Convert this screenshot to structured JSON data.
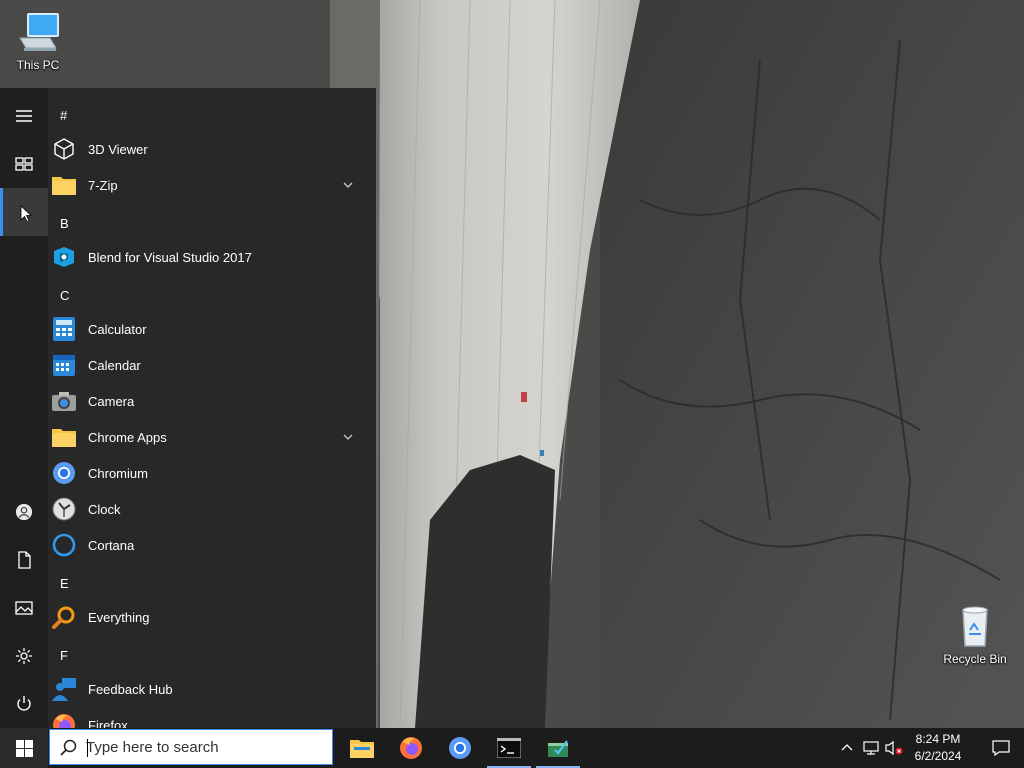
{
  "desktop": {
    "icons": [
      {
        "label": "This PC",
        "icon": "computer-icon"
      },
      {
        "label": "Recycle Bin",
        "icon": "recycle-bin-icon"
      }
    ]
  },
  "start_menu": {
    "rail": [
      {
        "name": "expand",
        "icon": "hamburger-icon"
      },
      {
        "name": "tiles",
        "icon": "tiles-icon"
      },
      {
        "name": "all-apps",
        "icon": "all-apps-icon",
        "active": true
      },
      {
        "name": "account",
        "icon": "user-icon"
      },
      {
        "name": "documents",
        "icon": "document-icon"
      },
      {
        "name": "pictures",
        "icon": "pictures-icon"
      },
      {
        "name": "settings",
        "icon": "gear-icon"
      },
      {
        "name": "power",
        "icon": "power-icon"
      }
    ],
    "headers": {
      "hash": "#",
      "b": "B",
      "c": "C",
      "e": "E",
      "f": "F"
    },
    "apps": {
      "viewer3d": {
        "label": "3D Viewer",
        "icon": "cube-icon"
      },
      "sevenzip": {
        "label": "7-Zip",
        "icon": "folder-icon",
        "expandable": true
      },
      "blend": {
        "label": "Blend for Visual Studio 2017",
        "icon": "blend-icon"
      },
      "calculator": {
        "label": "Calculator",
        "icon": "calculator-icon"
      },
      "calendar": {
        "label": "Calendar",
        "icon": "calendar-icon"
      },
      "camera": {
        "label": "Camera",
        "icon": "camera-icon"
      },
      "chromeapps": {
        "label": "Chrome Apps",
        "icon": "folder-icon",
        "expandable": true
      },
      "chromium": {
        "label": "Chromium",
        "icon": "chromium-icon"
      },
      "clock": {
        "label": "Clock",
        "icon": "clock-icon"
      },
      "cortana": {
        "label": "Cortana",
        "icon": "cortana-icon"
      },
      "everything": {
        "label": "Everything",
        "icon": "magnifier-icon"
      },
      "feedback": {
        "label": "Feedback Hub",
        "icon": "feedback-icon"
      },
      "firefox": {
        "label": "Firefox",
        "icon": "firefox-icon"
      }
    }
  },
  "taskbar": {
    "search": {
      "placeholder": "Type here to search"
    },
    "pinned": [
      {
        "name": "file-explorer",
        "icon": "folder-icon"
      },
      {
        "name": "firefox",
        "icon": "firefox-icon"
      },
      {
        "name": "chromium",
        "icon": "chromium-icon"
      },
      {
        "name": "terminal",
        "icon": "terminal-icon",
        "running": true
      },
      {
        "name": "task-app",
        "icon": "task-app-icon",
        "running": true
      }
    ],
    "tray": {
      "time": "8:24 PM",
      "date": "6/2/2024",
      "icons": [
        "chevron-up-icon",
        "network-icon",
        "volume-muted-icon",
        "notification-icon"
      ]
    }
  },
  "colors": {
    "accent": "#3b8eea",
    "menu_bg": "#282828",
    "rail_bg": "#1f1f1f",
    "taskbar_bg": "#1c1c1c"
  }
}
